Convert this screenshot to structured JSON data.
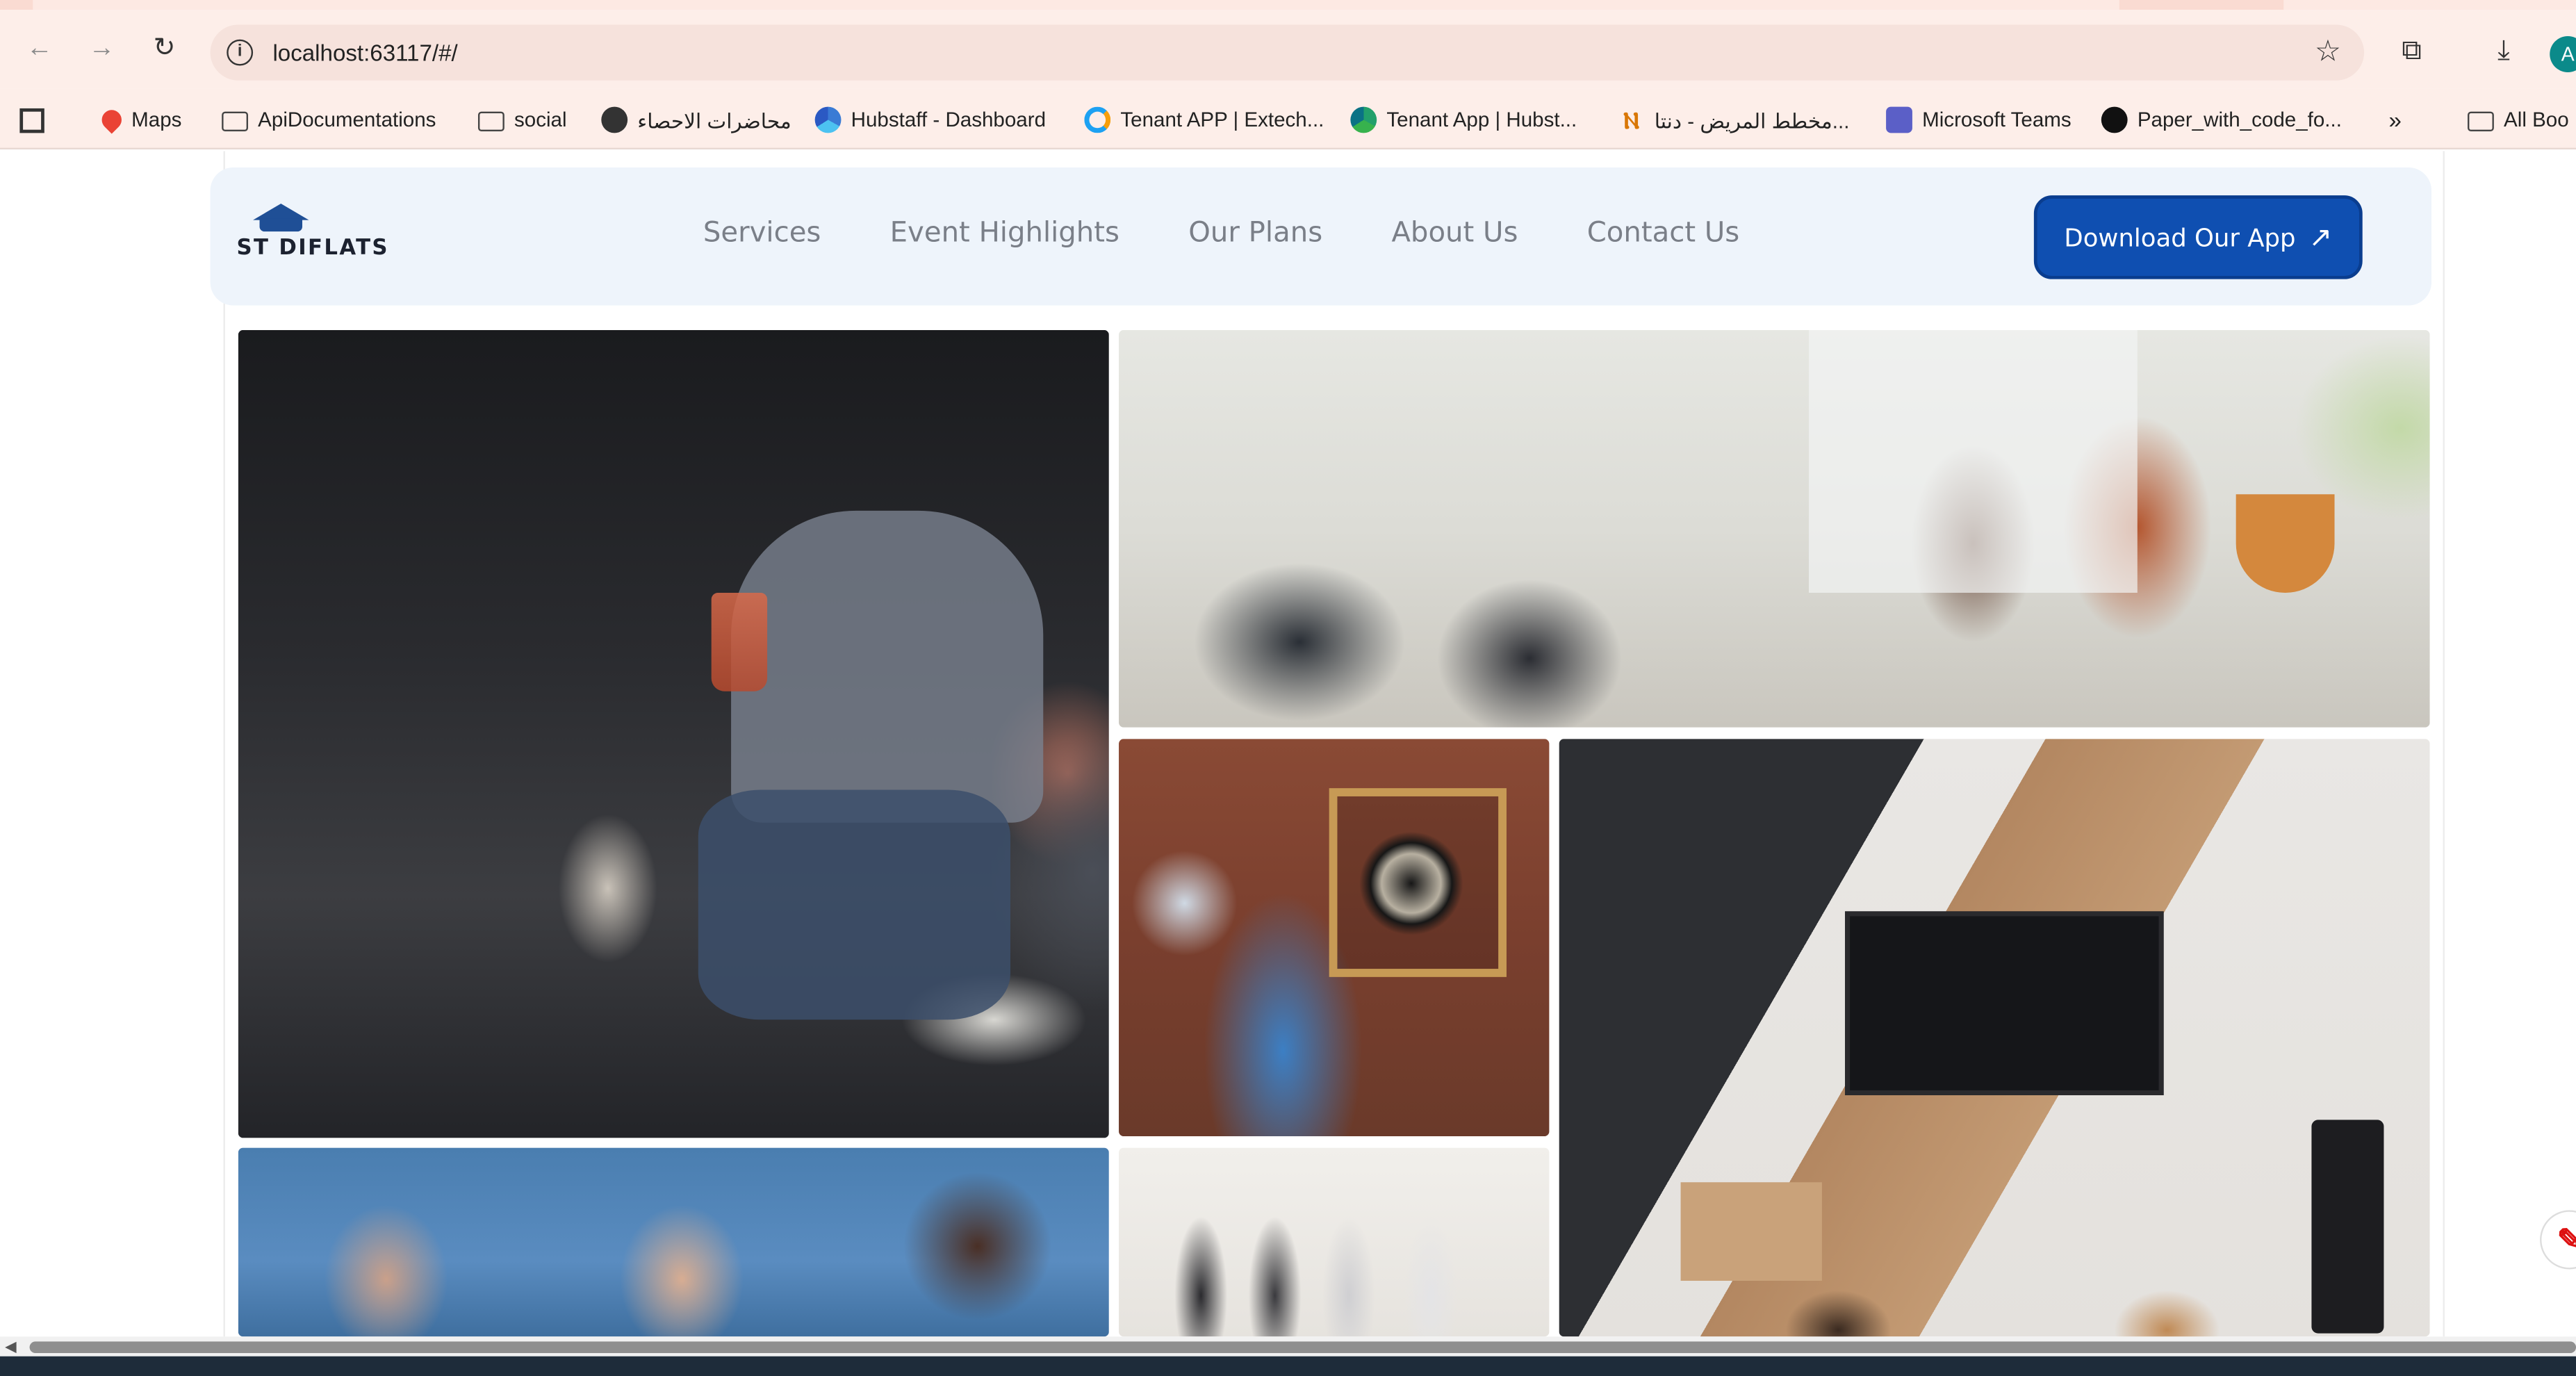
{
  "browser": {
    "url": "localhost:63117/#/",
    "profile_initial": "A",
    "bookmarks": [
      {
        "label": "Maps",
        "icon": "maps-pin-icon"
      },
      {
        "label": "ApiDocumentations",
        "icon": "folder-icon"
      },
      {
        "label": "social",
        "icon": "folder-icon"
      },
      {
        "label": "محاضرات الاحصاء",
        "icon": "globe-icon"
      },
      {
        "label": "Hubstaff - Dashboard",
        "icon": "hubstaff-icon"
      },
      {
        "label": "Tenant APP | Extech...",
        "icon": "tenant-icon"
      },
      {
        "label": "Tenant App | Hubst...",
        "icon": "hubstaff-icon"
      },
      {
        "label": "مخطط المريض - دنتا...",
        "icon": "dental-icon"
      },
      {
        "label": "Microsoft Teams",
        "icon": "teams-icon"
      },
      {
        "label": "Paper_with_code_fo...",
        "icon": "github-icon"
      }
    ],
    "overflow_label": "»",
    "all_bookmarks_label": "All Boo"
  },
  "site": {
    "logo_text": "ST  DIFLATS",
    "nav": [
      "Services",
      "Event Highlights",
      "Our Plans",
      "About Us",
      "Contact Us"
    ],
    "cta_label": "Download Our App"
  },
  "gallery": {
    "photos": [
      "cinema-audience-photo",
      "classroom-presentation-photo",
      "darts-game-photo",
      "tv-lounge-photo",
      "group-meeting-photo",
      "friends-walking-photo"
    ]
  },
  "colors": {
    "header_bg": "#eef4fb",
    "cta_bg": "#0f4fb1",
    "nav_text": "#7a7f88",
    "browser_chrome": "#fdeee9"
  }
}
